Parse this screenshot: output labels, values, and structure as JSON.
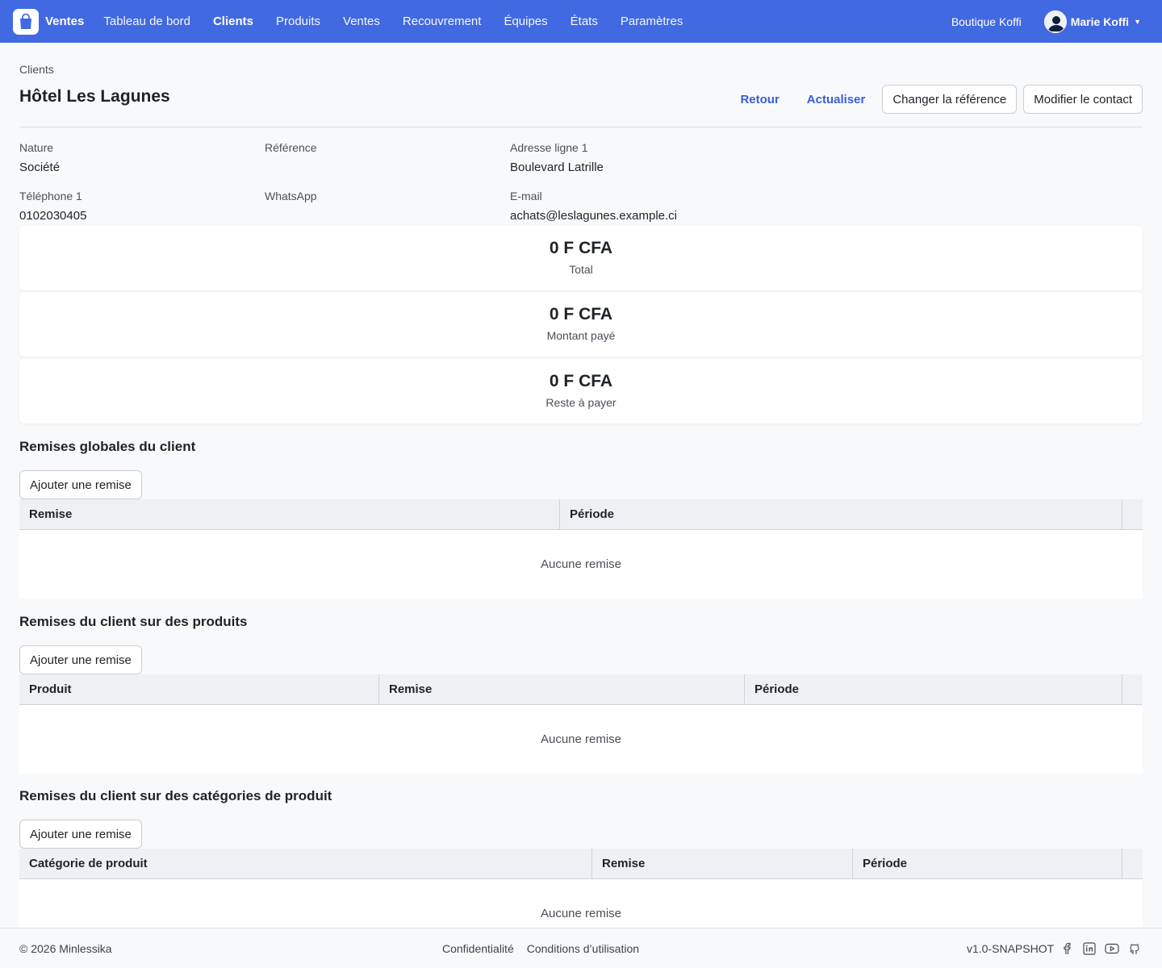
{
  "app": {
    "name": "Ventes"
  },
  "nav": {
    "items": [
      {
        "label": "Tableau de bord"
      },
      {
        "label": "Clients"
      },
      {
        "label": "Produits"
      },
      {
        "label": "Ventes"
      },
      {
        "label": "Recouvrement"
      },
      {
        "label": "Équipes"
      },
      {
        "label": "États"
      },
      {
        "label": "Paramètres"
      }
    ],
    "active": "Clients"
  },
  "header": {
    "shop": "Boutique Koffi",
    "user": "Marie Koffi"
  },
  "page": {
    "breadcrumb": "Clients",
    "title": "Hôtel Les Lagunes",
    "actions": {
      "back": "Retour",
      "refresh": "Actualiser",
      "change_ref": "Changer la référence",
      "edit_contact": "Modifier le contact"
    }
  },
  "details": {
    "nature": {
      "label": "Nature",
      "value": "Société"
    },
    "reference": {
      "label": "Référence",
      "value": ""
    },
    "address1": {
      "label": "Adresse ligne 1",
      "value": "Boulevard Latrille"
    },
    "phone1": {
      "label": "Téléphone 1",
      "value": "0102030405"
    },
    "whatsapp": {
      "label": "WhatsApp",
      "value": ""
    },
    "email": {
      "label": "E-mail",
      "value": "achats@leslagunes.example.ci"
    }
  },
  "stats": [
    {
      "amount": "0 F CFA",
      "label": "Total"
    },
    {
      "amount": "0 F CFA",
      "label": "Montant payé"
    },
    {
      "amount": "0 F CFA",
      "label": "Reste à payer"
    }
  ],
  "sections": {
    "global": {
      "title": "Remises globales du client",
      "add_label": "Ajouter une remise",
      "columns": [
        "Remise",
        "Période"
      ],
      "empty": "Aucune remise"
    },
    "products": {
      "title": "Remises du client sur des produits",
      "add_label": "Ajouter une remise",
      "columns": [
        "Produit",
        "Remise",
        "Période"
      ],
      "empty": "Aucune remise"
    },
    "categories": {
      "title": "Remises du client sur des catégories de produit",
      "add_label": "Ajouter une remise",
      "columns": [
        "Catégorie de produit",
        "Remise",
        "Période"
      ],
      "empty": "Aucune remise"
    }
  },
  "footer": {
    "copyright": "© 2026 Minlessika",
    "links": [
      "Confidentialité",
      "Conditions d’utilisation"
    ],
    "version": "v1.0-SNAPSHOT",
    "socials": [
      "facebook-icon",
      "linkedin-icon",
      "youtube-icon",
      "github-icon"
    ]
  },
  "colors": {
    "primary": "#4169e1",
    "link": "#3b5fd6"
  }
}
